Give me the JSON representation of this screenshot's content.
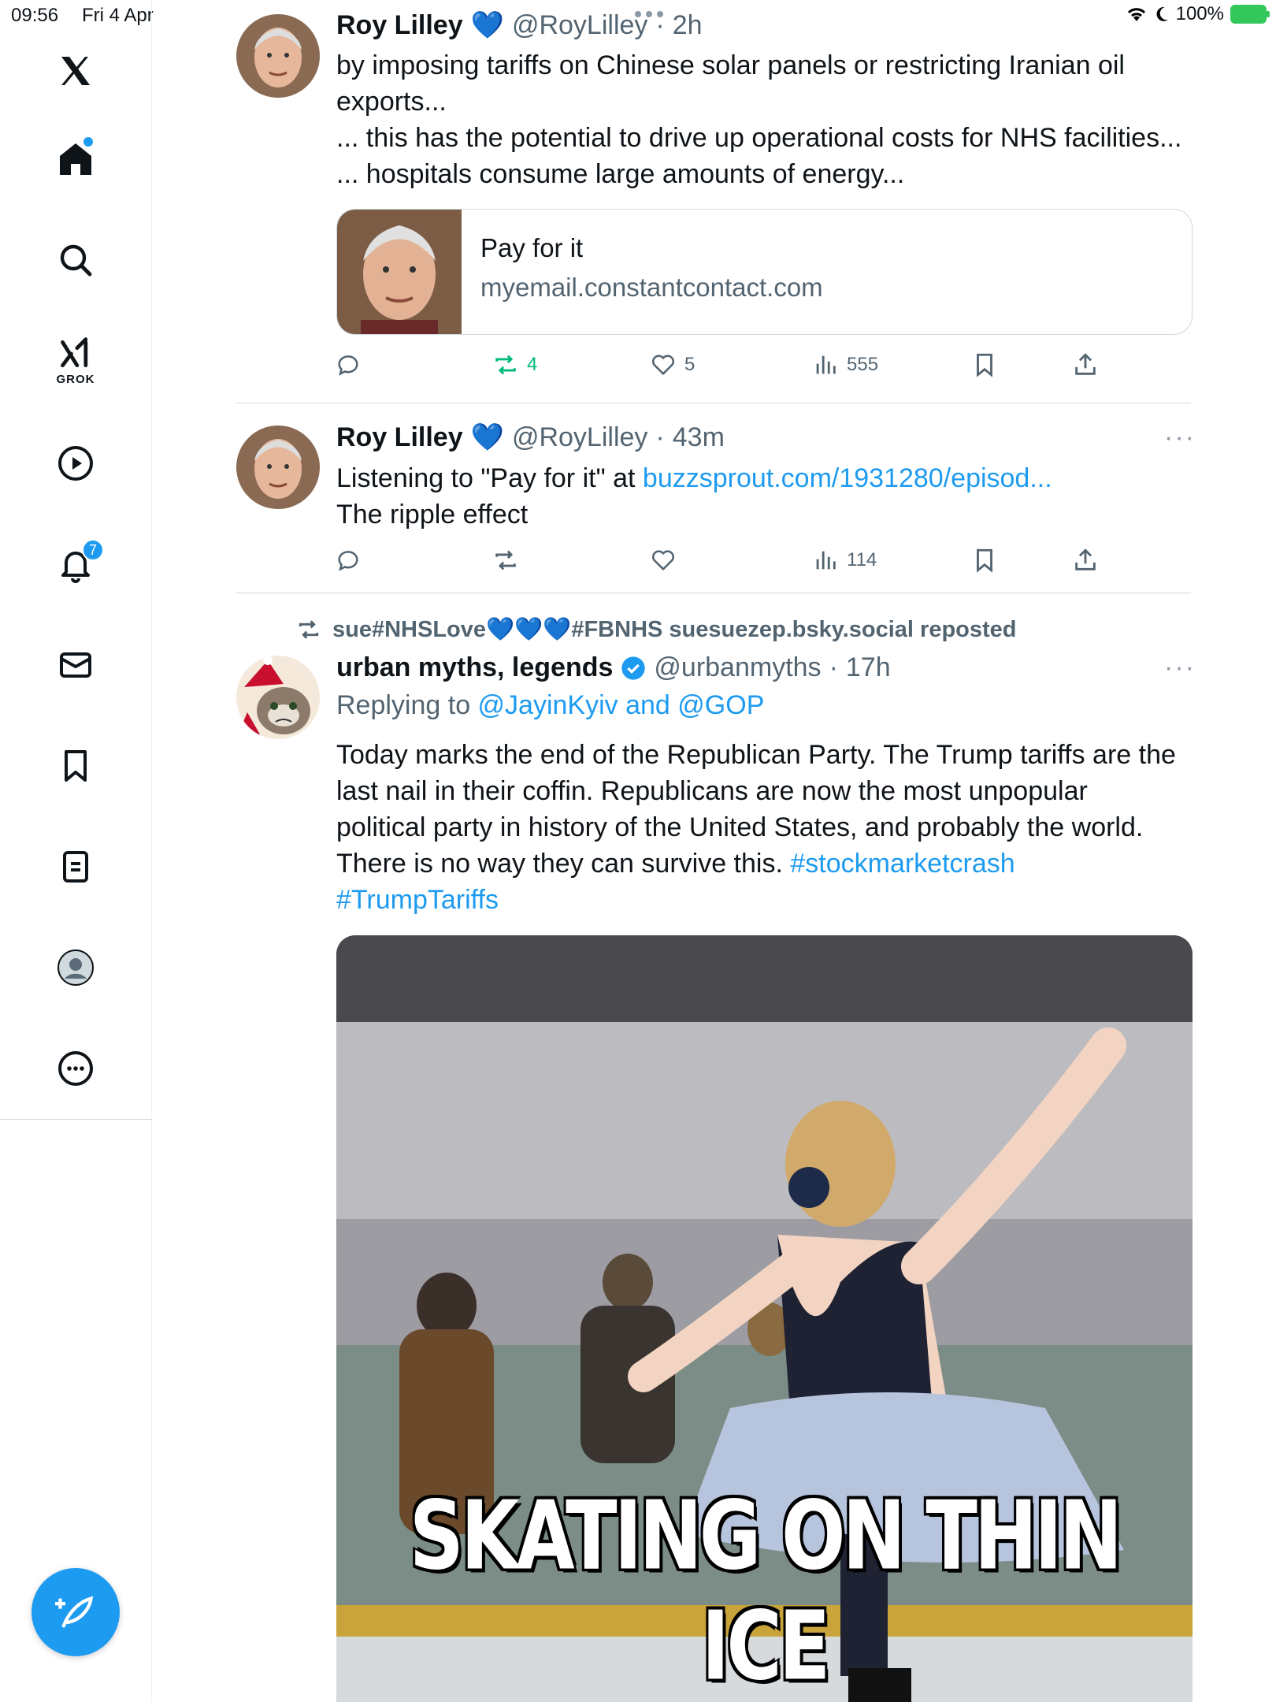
{
  "status_bar": {
    "time": "09:56",
    "date": "Fri 4 Apr",
    "battery": "100%"
  },
  "sidebar": {
    "items": [
      {
        "name": "x-logo"
      },
      {
        "name": "home",
        "has_dot": true
      },
      {
        "name": "search"
      },
      {
        "name": "grok",
        "label": "GROK"
      },
      {
        "name": "video"
      },
      {
        "name": "notifications",
        "badge": "7"
      },
      {
        "name": "messages"
      },
      {
        "name": "bookmarks"
      },
      {
        "name": "lists"
      },
      {
        "name": "profile"
      },
      {
        "name": "more"
      }
    ]
  },
  "posts": [
    {
      "author": "Roy Lilley",
      "handle": "@RoyLilley",
      "time": "2h",
      "lines": [
        "by imposing tariffs on Chinese solar panels or restricting Iranian oil",
        "exports...",
        "... this has the potential to drive up operational costs for NHS facilities...",
        "... hospitals consume large amounts of energy..."
      ],
      "card": {
        "title": "Pay for it",
        "domain": "myemail.constantcontact.com"
      },
      "stats": {
        "replies": "",
        "reposts": "4",
        "likes": "5",
        "views": "555"
      }
    },
    {
      "author": "Roy Lilley",
      "handle": "@RoyLilley",
      "time": "43m",
      "text_prefix": "Listening to \"Pay for it\" at ",
      "link": "buzzsprout.com/1931280/episod...",
      "text_line2": "The ripple effect",
      "stats": {
        "replies": "",
        "reposts": "",
        "likes": "",
        "views": "114"
      }
    },
    {
      "repost_banner": "sue#NHSLove💙💙💙#FBNHS suesuezep.bsky.social reposted",
      "author": "urban myths, legends",
      "handle": "@urbanmyths",
      "time": "17h",
      "replying_prefix": "Replying to ",
      "replying_to": "@JayinKyiv and @GOP",
      "lines": [
        "Today marks the end of the Republican Party. The Trump tariffs are the",
        "last nail in their coffin. Republicans are now the most unpopular",
        "political party in history of the United States, and probably the world."
      ],
      "last_line_prefix": "There is no way they can survive this. ",
      "hashtag1": "#stockmarketcrash",
      "hashtag2": "#TrumpTariffs",
      "media_caption": "SKATING ON THIN ICE"
    }
  ],
  "colors": {
    "accent": "#1d9bf0",
    "repost_green": "#00ba7c",
    "secondary_text": "#536471"
  }
}
